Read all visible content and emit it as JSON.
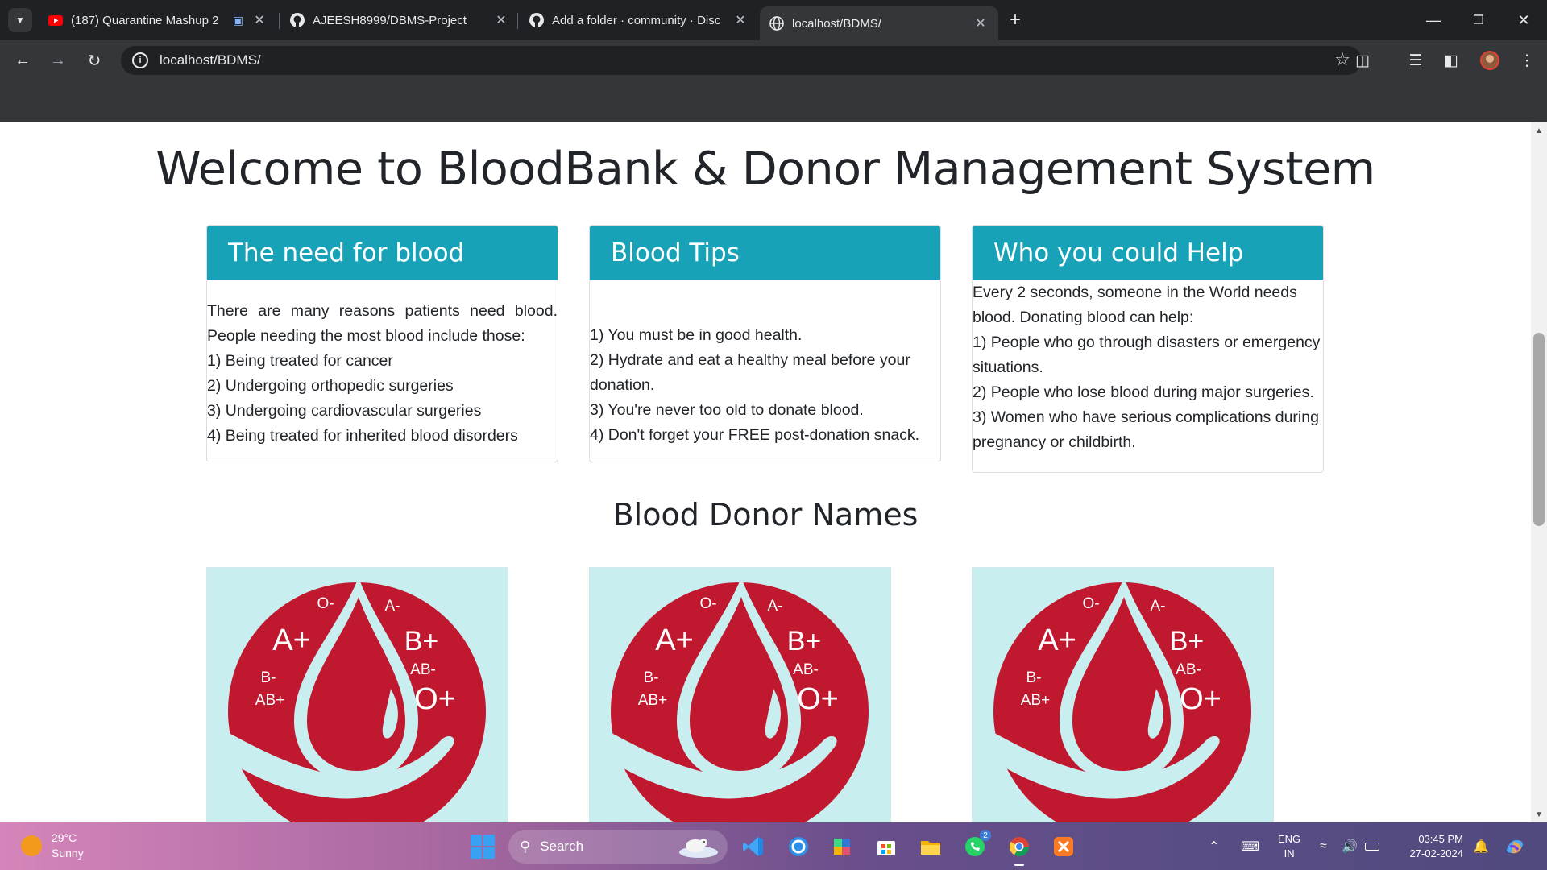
{
  "browser": {
    "tabs": [
      {
        "title": "(187) Quarantine Mashup 2",
        "icon": "youtube-icon",
        "active": false
      },
      {
        "title": "AJEESH8999/DBMS-Project",
        "icon": "github-icon",
        "active": false
      },
      {
        "title": "Add a folder · community · Disc",
        "icon": "github-icon",
        "active": false
      },
      {
        "title": "localhost/BDMS/",
        "icon": "globe-icon",
        "active": true
      }
    ],
    "address": "localhost/BDMS/"
  },
  "page": {
    "heading": "Welcome to BloodBank & Donor Management System",
    "cards": [
      {
        "title": "The need for blood",
        "lines": [
          "There are many reasons patients need blood. People needing the most blood include those:",
          "1) Being treated for cancer",
          "2) Undergoing orthopedic surgeries",
          "3) Undergoing cardiovascular surgeries",
          "4) Being treated for inherited blood disorders"
        ]
      },
      {
        "title": "Blood Tips",
        "lines": [
          "1) You must be in good health.",
          "2) Hydrate and eat a healthy meal before your donation.",
          "3) You're never too old to donate blood.",
          "4) Don't forget your FREE post-donation snack."
        ]
      },
      {
        "title": "Who you could Help",
        "lines": [
          "Every 2 seconds, someone in the World needs blood. Donating blood can help:",
          "1) People who go through disasters or emergency situations.",
          "2) People who lose blood during major surgeries.",
          "3) Women who have serious complications during pregnancy or childbirth."
        ]
      }
    ],
    "donor_heading": "Blood Donor Names",
    "blood_logo": {
      "groups": [
        "O-",
        "A-",
        "A+",
        "B+",
        "B-",
        "AB-",
        "AB+",
        "O+"
      ],
      "color": "#c0182f",
      "background": "#c9eef0"
    }
  },
  "taskbar": {
    "weather_temp": "29°C",
    "weather_desc": "Sunny",
    "search_label": "Search",
    "whatsapp_badge": "2",
    "lang_1": "ENG",
    "lang_2": "IN",
    "time": "03:45 PM",
    "date": "27-02-2024"
  },
  "colors": {
    "card_header": "#17a2b8",
    "chrome_dark": "#202124",
    "chrome_toolbar": "#35363a"
  }
}
